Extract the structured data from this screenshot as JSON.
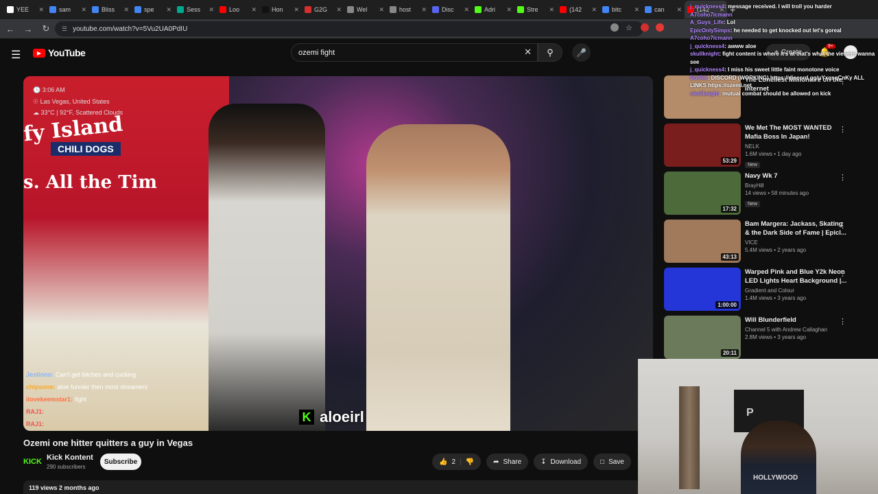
{
  "browser": {
    "tabs": [
      {
        "label": "YEE",
        "color": "#ffffff"
      },
      {
        "label": "sam",
        "color": "#4285f4"
      },
      {
        "label": "Bliss",
        "color": "#4285f4"
      },
      {
        "label": "spe",
        "color": "#4285f4"
      },
      {
        "label": "Sess",
        "color": "#00a88f"
      },
      {
        "label": "Loo",
        "color": "#ff0000"
      },
      {
        "label": "Hon",
        "color": "#111111"
      },
      {
        "label": "G2G",
        "color": "#d32f2f"
      },
      {
        "label": "Wel",
        "color": "#888888"
      },
      {
        "label": "host",
        "color": "#888888"
      },
      {
        "label": "Disc",
        "color": "#5865f2"
      },
      {
        "label": "Adri",
        "color": "#53fc18"
      },
      {
        "label": "Stre",
        "color": "#53fc18"
      },
      {
        "label": "(142",
        "color": "#ff0000"
      },
      {
        "label": "bitc",
        "color": "#4285f4"
      },
      {
        "label": "can",
        "color": "#4285f4"
      },
      {
        "label": "(142",
        "color": "#ff0000"
      }
    ],
    "url": "youtube.com/watch?v=5Vu2UA0PdIU"
  },
  "header": {
    "logo_text": "YouTube",
    "search_value": "ozemi fight",
    "create_label": "Create",
    "notif_count": "9+"
  },
  "video": {
    "overlay": {
      "time": "3:06 AM",
      "location": "Las Vegas, United States",
      "weather": "33°C | 92°F, Scattered Clouds"
    },
    "sign_text": "fy Island",
    "sign_sub": "CHILI DOGS",
    "sign_line2": "s. All the Tim",
    "chat": [
      {
        "user": "Jestinno:",
        "msg": "Can't get bitches and cucking",
        "color": "#8ab4f8"
      },
      {
        "user": "chipsone:",
        "msg": "aloe funnier then most streamers",
        "color": "#f9a825"
      },
      {
        "user": "ilovekeemstar1:",
        "msg": "fight",
        "color": "#ff7043"
      },
      {
        "user": "RAJ1:",
        "msg": "",
        "color": "#ef5350"
      },
      {
        "user": "RAJ1:",
        "msg": "",
        "color": "#ef5350"
      }
    ],
    "streamer_tag": "aloeirl",
    "title": "Ozemi one hitter quitters a guy in Vegas",
    "channel": "Kick Kontent",
    "channel_logo": "KICK",
    "subscribers": "290 subscribers",
    "subscribe_label": "Subscribe",
    "likes": "2",
    "share_label": "Share",
    "download_label": "Download",
    "save_label": "Save",
    "views_date": "119 views  2 months ago"
  },
  "recommendations": [
    {
      "title": "The Loneliest Millionaire on the Internet",
      "channel": "",
      "stats": "",
      "duration": "",
      "thumb": "#b58c6a",
      "new": ""
    },
    {
      "title": "We Met The MOST WANTED Mafia Boss In Japan!",
      "channel": "NELK",
      "stats": "1.6M views • 1 day ago",
      "duration": "53:29",
      "thumb": "#7a1d1d",
      "new": "New"
    },
    {
      "title": "Navy Wk 7",
      "channel": "BrayHill",
      "stats": "14 views • 58 minutes ago",
      "duration": "17:32",
      "thumb": "#4d6b3a",
      "new": "New"
    },
    {
      "title": "Bam Margera: Jackass, Skating & the Dark Side of Fame | Epicl...",
      "channel": "VICE",
      "stats": "5.4M views • 2 years ago",
      "duration": "43:13",
      "thumb": "#a07a5a",
      "new": ""
    },
    {
      "title": "Warped Pink and Blue Y2k Neon LED Lights Heart Background |...",
      "channel": "Gradient and Colour",
      "stats": "1.4M views • 3 years ago",
      "duration": "1:00:00",
      "thumb": "#2436d8",
      "new": ""
    },
    {
      "title": "Will Blunderfield",
      "channel": "Channel 5 with Andrew Callaghan",
      "stats": "2.8M views • 3 years ago",
      "duration": "20:11",
      "thumb": "#6a7a5a",
      "new": ""
    }
  ],
  "chat_overlay": [
    {
      "user": "j_quickness4",
      "msg": ": message received. I will troll you harder"
    },
    {
      "user": "A7coho7icmann",
      "msg": ""
    },
    {
      "user": "A_Guys_Life",
      "msg": ": Lol"
    },
    {
      "user": "EpicOnlySimps",
      "msg": ": he needed to get knocked out let's goreal"
    },
    {
      "user": "A7coho7icmann",
      "msg": ""
    },
    {
      "user": "j_quickness4",
      "msg": ": awww aloe"
    },
    {
      "user": "skullknight",
      "msg": ": fight content is where it's at that's what the viewers wanna see"
    },
    {
      "user": "j_quickness4",
      "msg": ": I miss his sweet little faint monotone voice"
    },
    {
      "user": "BotRix",
      "msg": ": DISCORD (WORKING) https://discord.gg/uYxqsqCnKy ALL LINKS https://ozemi.net"
    },
    {
      "user": "skullknight",
      "msg": ": mutual combat should be allowed on kick"
    }
  ],
  "webcam": {
    "flag_text": "P",
    "shirt_text": "HOLLYWOOD"
  }
}
